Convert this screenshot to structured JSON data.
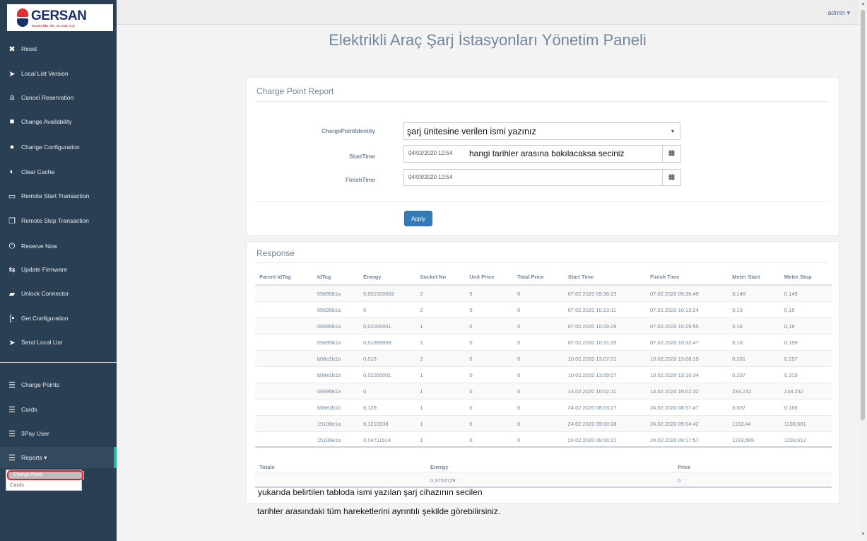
{
  "logo": {
    "brand": "GERSAN",
    "subtitle": "ELEKTRİK TİC. ve SAN. A.Ş."
  },
  "sidebar": {
    "items": [
      {
        "label": "Reset",
        "icon": "✖"
      },
      {
        "label": "Local List Version",
        "icon": "➤"
      },
      {
        "label": "Cancel Reservation",
        "icon": "a"
      },
      {
        "label": "Change Availability",
        "icon": "■"
      },
      {
        "label": "Change Configuration",
        "icon": "●"
      },
      {
        "label": "Clear Cache",
        "icon": "◐"
      },
      {
        "label": "Remote Start Transaction",
        "icon": "▭"
      },
      {
        "label": "Remote Stop Transaction",
        "icon": "❐"
      },
      {
        "label": "Reserve Now",
        "icon": "⏻"
      },
      {
        "label": "Update Firmware",
        "icon": "⇆"
      },
      {
        "label": "Unlock Connector",
        "icon": "▰"
      },
      {
        "label": "Get Configuration",
        "icon": "[▪"
      },
      {
        "label": "Send Local List",
        "icon": "➤"
      }
    ],
    "items2": [
      {
        "label": "Charge Points",
        "icon": "☰"
      },
      {
        "label": "Cards",
        "icon": "☰"
      },
      {
        "label": "3Pay User",
        "icon": "☰"
      },
      {
        "label": "Reports ▾",
        "icon": "☰"
      }
    ],
    "submenu": {
      "charge_point": "Charge Point",
      "cards": "Cards"
    }
  },
  "topbar": {
    "user": "admin ▾"
  },
  "page_title": "Elektrikli Araç Şarj İstasyonları Yönetim Paneli",
  "report_panel": {
    "title": "Charge Point Report",
    "fields": {
      "charge_point_identity": {
        "label": "ChargePointIdentity",
        "value": "şarj ünitesine verilen ismi yazınız",
        "caret": "▾"
      },
      "start_time": {
        "label": "StartTime",
        "value": "04/02/2020 12:54",
        "note": "hangi tarihler arasına bakılacaksa seciniz",
        "icon": "▦"
      },
      "finish_time": {
        "label": "FinishTime",
        "value": "04/03/2020 12:54",
        "icon": "▦"
      }
    },
    "apply_label": "Apply"
  },
  "response_panel": {
    "title": "Response",
    "columns": [
      "Parent IdTag",
      "IdTag",
      "Energy",
      "Socket No",
      "Unit Price",
      "Total Price",
      "Start Time",
      "Finish Time",
      "Meter Start",
      "Meter Stop"
    ],
    "rows": [
      [
        "",
        "0569581a",
        "0,001000002",
        "2",
        "0",
        "0",
        "07.02.2020 09:36:23",
        "07.02.2020 09:36:49",
        "0,148",
        "0,149"
      ],
      [
        "",
        "0569581a",
        "0",
        "2",
        "0",
        "0",
        "07.02.2020 10:13:11",
        "07.02.2020 10:13:24",
        "0,15",
        "0,15"
      ],
      [
        "",
        "0569581a",
        "0,02000001",
        "1",
        "0",
        "0",
        "07.02.2020 10:29:29",
        "07.02.2020 10:29:55",
        "0,16",
        "0,18"
      ],
      [
        "",
        "0569581a",
        "0,01899999",
        "2",
        "0",
        "0",
        "07.02.2020 10:31:25",
        "07.02.2020 10:32:47",
        "0,18",
        "0,199"
      ],
      [
        "",
        "b08e2b1b",
        "0,016",
        "2",
        "0",
        "0",
        "10.02.2020 13:07:01",
        "10.02.2020 13:08:19",
        "0,281",
        "0,297"
      ],
      [
        "",
        "b08e2b1b",
        "0,02200001",
        "1",
        "0",
        "0",
        "10.02.2020 13:09:07",
        "10.02.2020 13:10:34",
        "0,297",
        "0,319"
      ],
      [
        "",
        "0569581a",
        "0",
        "1",
        "0",
        "0",
        "14.02.2020 16:02:11",
        "14.02.2020 16:02:32",
        "233,232",
        "233,232"
      ],
      [
        "",
        "b08e2b1b",
        "0,129",
        "1",
        "0",
        "0",
        "24.02.2020 08:53:27",
        "24.02.2020 08:57:47",
        "0,037",
        "0,166"
      ],
      [
        "",
        "15108e1a",
        "0,1210938",
        "1",
        "0",
        "0",
        "24.02.2020 09:00:38",
        "24.02.2020 09:04:42",
        "1193,44",
        "1193,561"
      ],
      [
        "",
        "15108e1a",
        "0,04711914",
        "1",
        "0",
        "0",
        "24.02.2020 09:16:21",
        "24.02.2020 09:17:57",
        "1193,565",
        "1193,612"
      ]
    ],
    "totals": {
      "label": "Totals",
      "energy_label": "Energy",
      "price_label": "Price",
      "energy_value": "0,3752129",
      "price_value": "0"
    },
    "note_line1": "yukarıda belirtilen tabloda ismi yazılan şarj cihazının secilen",
    "note_line2": "tarihler arasındaki tüm hareketlerini ayrıntılı şekilde görebilirsiniz."
  },
  "colors": {
    "sidebar": "#2a3f54",
    "accent": "#1abb9c",
    "primary": "#337ab7",
    "highlight": "#e31e24"
  }
}
